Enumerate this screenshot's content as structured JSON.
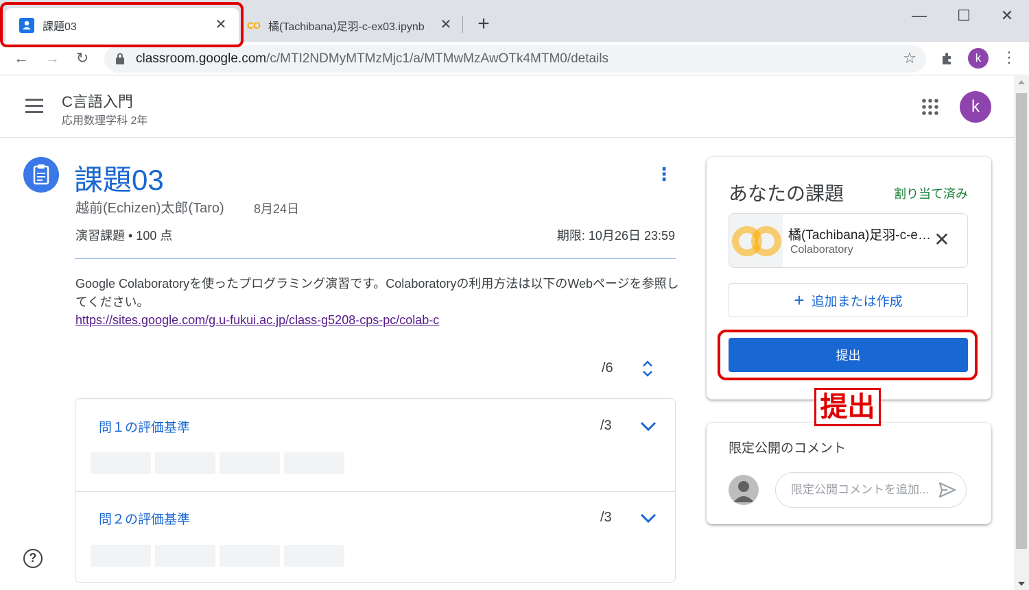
{
  "browser": {
    "tabs": [
      {
        "title": "課題03",
        "close": "✕"
      },
      {
        "title": "橘(Tachibana)足羽-c-ex03.ipynb",
        "close": "✕"
      }
    ],
    "new_tab": "+",
    "window_controls": {
      "minimize": "—",
      "maximize": "☐",
      "close": "✕"
    },
    "url_host": "classroom.google.com",
    "url_path": "/c/MTI2NDMyMTMzMjc1/a/MTMwMzAwOTk4MTM0/details",
    "profile_initial": "k"
  },
  "classroom": {
    "class_name": "C言語入門",
    "class_section": "応用数理学科 2年",
    "account_initial": "k"
  },
  "assignment": {
    "title": "課題03",
    "author": "越前(Echizen)太郎(Taro)",
    "date": "8月24日",
    "points": "演習課題 • 100 点",
    "due": "期限: 10月26日 23:59",
    "description": "Google Colaboratoryを使ったプログラミング演習です。Colaboratoryの利用方法は以下のWebページを参照してください。",
    "link": "https://sites.google.com/g.u-fukui.ac.jp/class-g5208-cps-pc/colab-c",
    "rubric_total": "/6",
    "criteria": [
      {
        "title": "問１の評価基準",
        "score": "/3"
      },
      {
        "title": "問２の評価基準",
        "score": "/3"
      }
    ]
  },
  "your_work": {
    "title": "あなたの課題",
    "status": "割り当て済み",
    "attachment_name": "橘(Tachibana)足羽-c-ex03.ipynb",
    "attachment_type": "Colaboratory",
    "add_label": "追加または作成",
    "submit_label": "提出"
  },
  "private_comments": {
    "title": "限定公開のコメント",
    "placeholder": "限定公開コメントを追加..."
  },
  "annotation_label": "提出",
  "colors": {
    "accent": "#1967d2",
    "status_green": "#188038",
    "annotation_red": "#e00000"
  }
}
